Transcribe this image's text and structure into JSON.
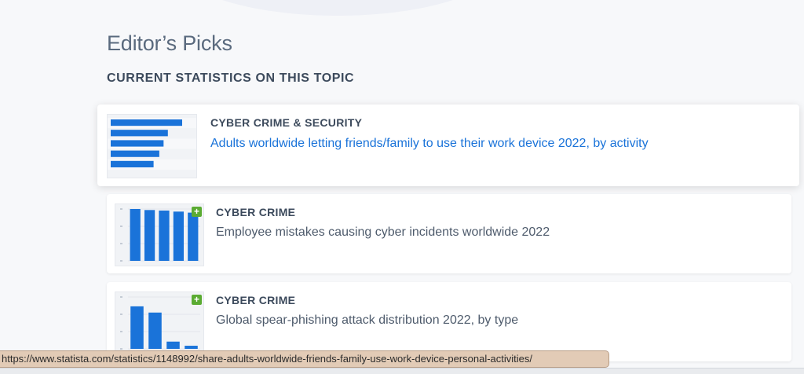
{
  "section": {
    "title": "Editor’s Picks",
    "subtitle": "CURRENT STATISTICS ON THIS TOPIC"
  },
  "cards": [
    {
      "category": "CYBER CRIME & SECURITY",
      "title": "Adults worldwide letting friends/family to use their work device 2022, by activity",
      "thumbnail_type": "horizontal-bar",
      "thumbnail_values": [
        1.0,
        0.8,
        0.74,
        0.68,
        0.6
      ],
      "has_premium_badge": false
    },
    {
      "category": "CYBER CRIME",
      "title": "Employee mistakes causing cyber incidents worldwide 2022",
      "thumbnail_type": "vertical-bar",
      "thumbnail_values": [
        1.0,
        0.98,
        0.97,
        0.95,
        0.93
      ],
      "has_premium_badge": true,
      "badge_label": "+"
    },
    {
      "category": "CYBER CRIME",
      "title": "Global spear-phishing attack distribution 2022, by type",
      "thumbnail_type": "vertical-bar",
      "thumbnail_values": [
        0.82,
        0.7,
        0.14,
        0.06
      ],
      "has_premium_badge": true,
      "badge_label": "+"
    }
  ],
  "status_bar": {
    "url": "https://www.statista.com/statistics/1148992/share-adults-worldwide-friends-family-use-work-device-personal-activities/"
  },
  "colors": {
    "bar_blue": "#1a73d9",
    "link_blue": "#1a73d9",
    "badge_green": "#5aab32",
    "heading": "#3c4a5c"
  }
}
